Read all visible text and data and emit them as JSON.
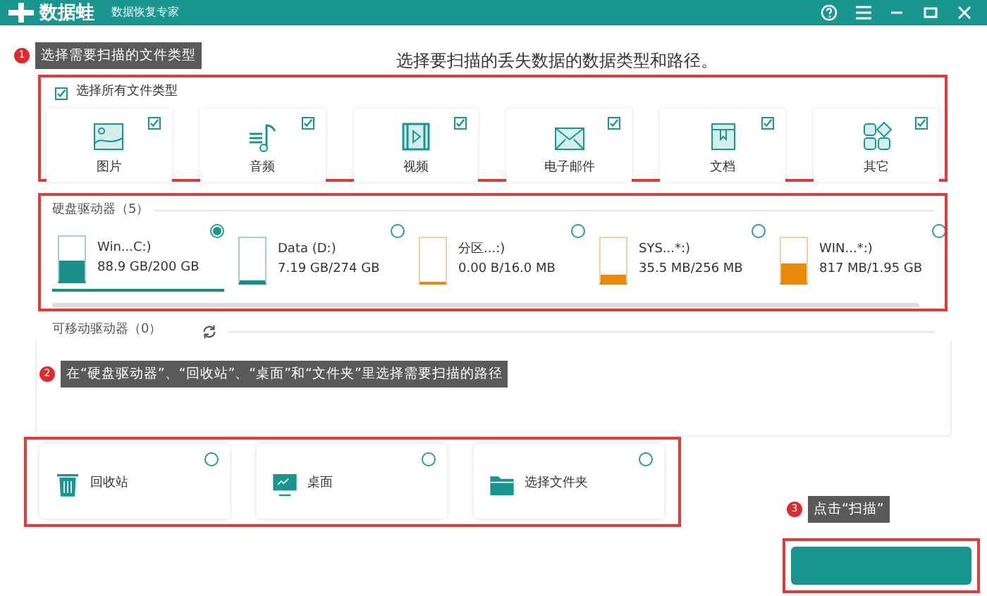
{
  "window": {
    "logo": "数据蛙",
    "subtitle": "数据恢复专家"
  },
  "heading": "选择要扫描的丢失数据的数据类型和路径。",
  "file_types": {
    "select_all": {
      "label": "选择所有文件类型",
      "checked": true
    },
    "items": [
      {
        "label": "图片",
        "kind": "image",
        "checked": true
      },
      {
        "label": "音频",
        "kind": "audio",
        "checked": true
      },
      {
        "label": "视频",
        "kind": "video",
        "checked": true
      },
      {
        "label": "电子邮件",
        "kind": "email",
        "checked": true
      },
      {
        "label": "文档",
        "kind": "document",
        "checked": true
      },
      {
        "label": "其它",
        "kind": "other",
        "checked": true
      }
    ]
  },
  "hard_drives": {
    "title": "硬盘驱动器（5）",
    "drives": [
      {
        "name": "Win...C:)",
        "usage": "88.9 GB/200 GB",
        "level": 0.44,
        "color": "#1a8f8a",
        "selected": true
      },
      {
        "name": "Data (D:)",
        "usage": "7.19 GB/274 GB",
        "level": 0.03,
        "color": "#1a8f8a",
        "selected": false
      },
      {
        "name": "分区...:)",
        "usage": "0.00  B/16.0 MB",
        "level": 0,
        "color": "#e8890c",
        "selected": false
      },
      {
        "name": "SYS...*:)",
        "usage": "35.5 MB/256 MB",
        "level": 0.14,
        "color": "#e8890c",
        "selected": false
      },
      {
        "name": "WIN...*:)",
        "usage": "817 MB/1.95 GB",
        "level": 0.41,
        "color": "#e8890c",
        "selected": false
      }
    ]
  },
  "removable": {
    "title": "可移动驱动器（0）"
  },
  "locations": [
    {
      "label": "回收站",
      "kind": "recycle",
      "selected": false
    },
    {
      "label": "桌面",
      "kind": "desktop",
      "selected": false
    },
    {
      "label": "选择文件夹",
      "kind": "folder",
      "selected": false
    }
  ],
  "callouts": [
    {
      "number": "1",
      "text": "选择需要扫描的文件类型"
    },
    {
      "number": "2",
      "text": "在“硬盘驱动器”、“回收站”、“桌面”和“文件夹”里选择需要扫描的路径"
    },
    {
      "number": "3",
      "text": "点击“扫描”"
    }
  ]
}
